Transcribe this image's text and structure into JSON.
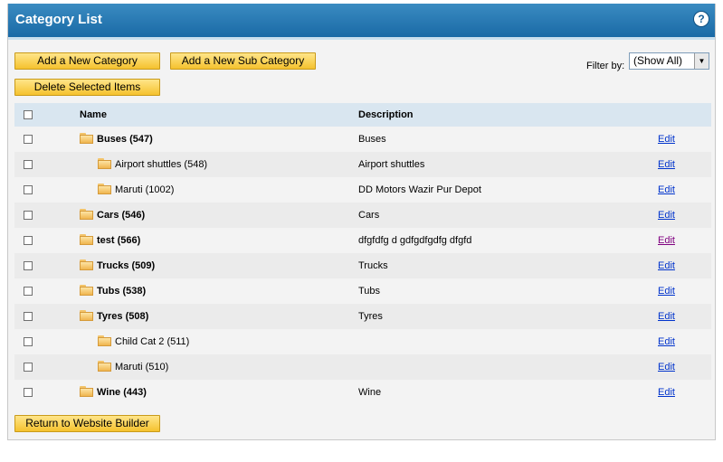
{
  "header": {
    "title": "Category List",
    "help": "?"
  },
  "toolbar": {
    "add_category": "Add a New Category",
    "add_sub_category": "Add a New Sub Category",
    "delete_selected": "Delete Selected Items",
    "return_builder": "Return to Website Builder"
  },
  "filter": {
    "label": "Filter by:",
    "value": "(Show All)"
  },
  "table": {
    "headers": {
      "name": "Name",
      "description": "Description"
    },
    "rows": [
      {
        "name": "Buses (547)",
        "description": "Buses",
        "level": 0,
        "edit": "Edit"
      },
      {
        "name": "Airport shuttles (548)",
        "description": "Airport shuttles",
        "level": 1,
        "edit": "Edit"
      },
      {
        "name": "Maruti (1002)",
        "description": "DD Motors Wazir Pur Depot",
        "level": 1,
        "edit": "Edit"
      },
      {
        "name": "Cars (546)",
        "description": "Cars",
        "level": 0,
        "edit": "Edit"
      },
      {
        "name": "test (566)",
        "description": "dfgfdfg d gdfgdfgdfg dfgfd",
        "level": 0,
        "edit": "Edit",
        "visited": true
      },
      {
        "name": "Trucks (509)",
        "description": "Trucks",
        "level": 0,
        "edit": "Edit"
      },
      {
        "name": "Tubs (538)",
        "description": "Tubs",
        "level": 0,
        "edit": "Edit"
      },
      {
        "name": "Tyres (508)",
        "description": "Tyres",
        "level": 0,
        "edit": "Edit"
      },
      {
        "name": "Child Cat 2 (511)",
        "description": "",
        "level": 1,
        "edit": "Edit"
      },
      {
        "name": "Maruti (510)",
        "description": "",
        "level": 1,
        "edit": "Edit"
      },
      {
        "name": "Wine (443)",
        "description": "Wine",
        "level": 0,
        "edit": "Edit"
      }
    ]
  },
  "colors": {
    "titlebar": "#1a6aa6",
    "button": "#f5c22e",
    "link": "#0033cc",
    "visited_link": "#800080",
    "header_row": "#d9e6f0"
  }
}
